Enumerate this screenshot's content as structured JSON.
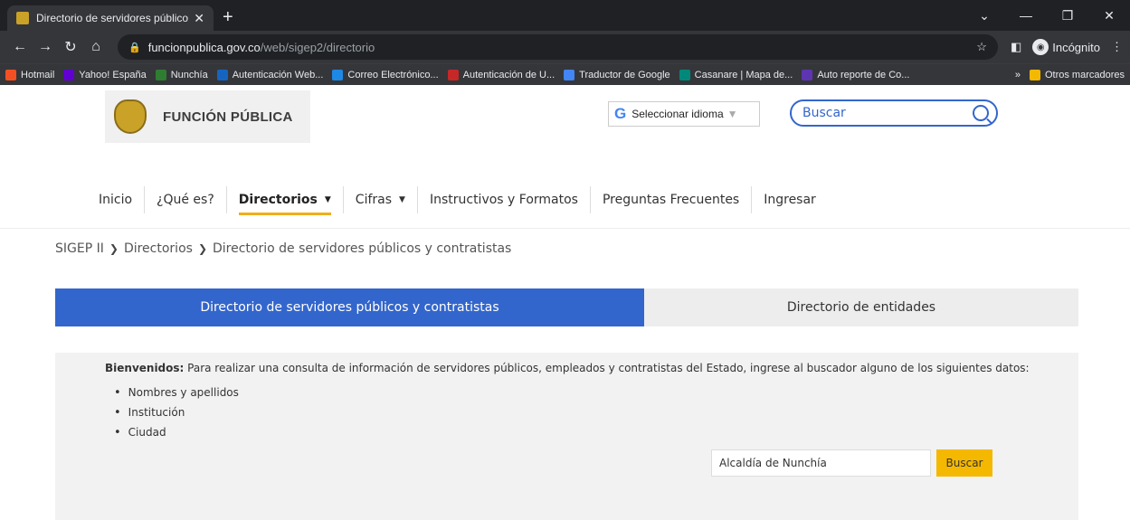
{
  "browser": {
    "tab_title": "Directorio de servidores públicos",
    "url_host": "funcionpublica.gov.co",
    "url_path": "/web/sigep2/directorio",
    "profile_label": "Incógnito",
    "bookmarks": [
      {
        "label": "Hotmail",
        "color": "#f25022"
      },
      {
        "label": "Yahoo! España",
        "color": "#6001d2"
      },
      {
        "label": "Nunchía",
        "color": "#2e7d32"
      },
      {
        "label": "Autenticación Web...",
        "color": "#1565c0"
      },
      {
        "label": "Correo Electrónico...",
        "color": "#1e88e5"
      },
      {
        "label": "Autenticación de U...",
        "color": "#c62828"
      },
      {
        "label": "Traductor de Google",
        "color": "#4285f4"
      },
      {
        "label": "Casanare | Mapa de...",
        "color": "#00897b"
      },
      {
        "label": "Auto reporte de Co...",
        "color": "#5e35b1"
      }
    ],
    "bookmarks_more": "»",
    "other_bookmarks": "Otros marcadores"
  },
  "header": {
    "brand": "FUNCIÓN PÚBLICA",
    "language_label": "Seleccionar idioma",
    "language_caret": "▼",
    "search_placeholder": "Buscar"
  },
  "nav": {
    "items": [
      "Inicio",
      "¿Qué es?",
      "Directorios",
      "Cifras",
      "Instructivos y Formatos",
      "Preguntas Frecuentes",
      "Ingresar"
    ]
  },
  "breadcrumb": [
    "SIGEP II",
    "Directorios",
    "Directorio de servidores públicos y contratistas"
  ],
  "tabs": {
    "active": "Directorio de servidores públicos y contratistas",
    "inactive": "Directorio de entidades"
  },
  "panel": {
    "welcome_bold": "Bienvenidos:",
    "welcome_text": " Para realizar una consulta de información de servidores públicos, empleados y contratistas del Estado, ingrese al buscador alguno de los siguientes datos:",
    "items": [
      "Nombres y apellidos",
      "Institución",
      "Ciudad"
    ],
    "query_value": "Alcaldía de Nunchía",
    "search_button": "Buscar"
  },
  "colors": {
    "accent_blue": "#3366cc",
    "accent_yellow": "#f5b800"
  }
}
